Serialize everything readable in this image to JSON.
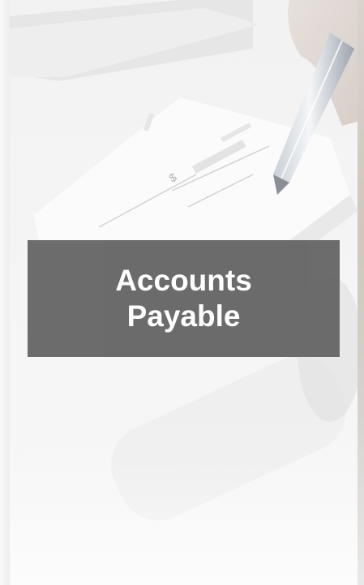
{
  "tile": {
    "title_line1": "Accounts",
    "title_line2": "Payable"
  },
  "photo": {
    "description_icon": "check-and-pen-photo",
    "check_amount_mark": "$"
  },
  "colors": {
    "banner_bg": "#666666",
    "banner_text": "#ffffff",
    "background": "#f6f6f6"
  }
}
